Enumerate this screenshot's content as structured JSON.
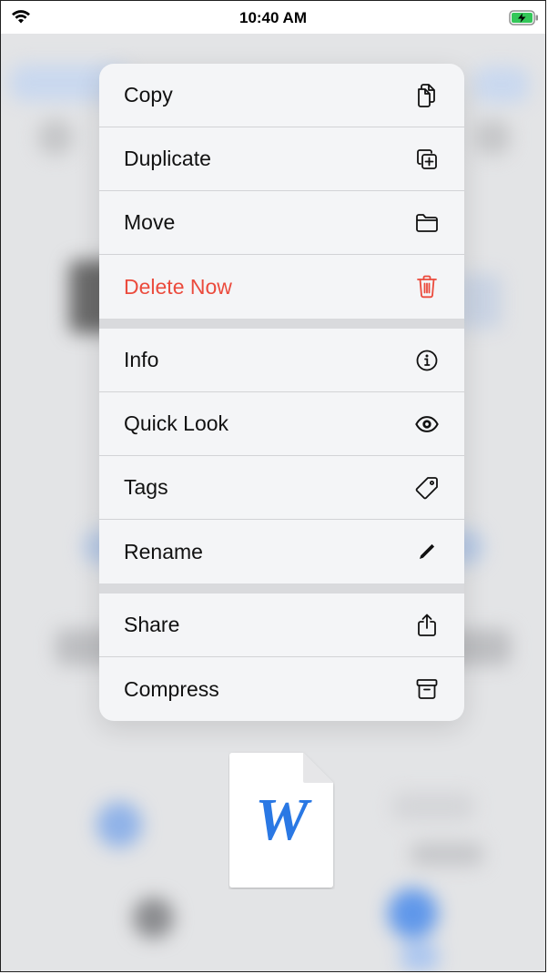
{
  "status_bar": {
    "time": "10:40 AM"
  },
  "menu": {
    "groups": [
      [
        {
          "label": "Copy",
          "icon": "copy-icon"
        },
        {
          "label": "Duplicate",
          "icon": "duplicate-icon"
        },
        {
          "label": "Move",
          "icon": "folder-icon"
        },
        {
          "label": "Delete Now",
          "icon": "trash-icon",
          "destructive": true
        }
      ],
      [
        {
          "label": "Info",
          "icon": "info-icon"
        },
        {
          "label": "Quick Look",
          "icon": "eye-icon"
        },
        {
          "label": "Tags",
          "icon": "tag-icon"
        },
        {
          "label": "Rename",
          "icon": "pencil-icon"
        }
      ],
      [
        {
          "label": "Share",
          "icon": "share-icon"
        },
        {
          "label": "Compress",
          "icon": "archive-icon"
        }
      ]
    ]
  },
  "file_preview": {
    "glyph": "W"
  },
  "colors": {
    "destructive": "#eb4b3d",
    "word_blue": "#2a78e4"
  }
}
